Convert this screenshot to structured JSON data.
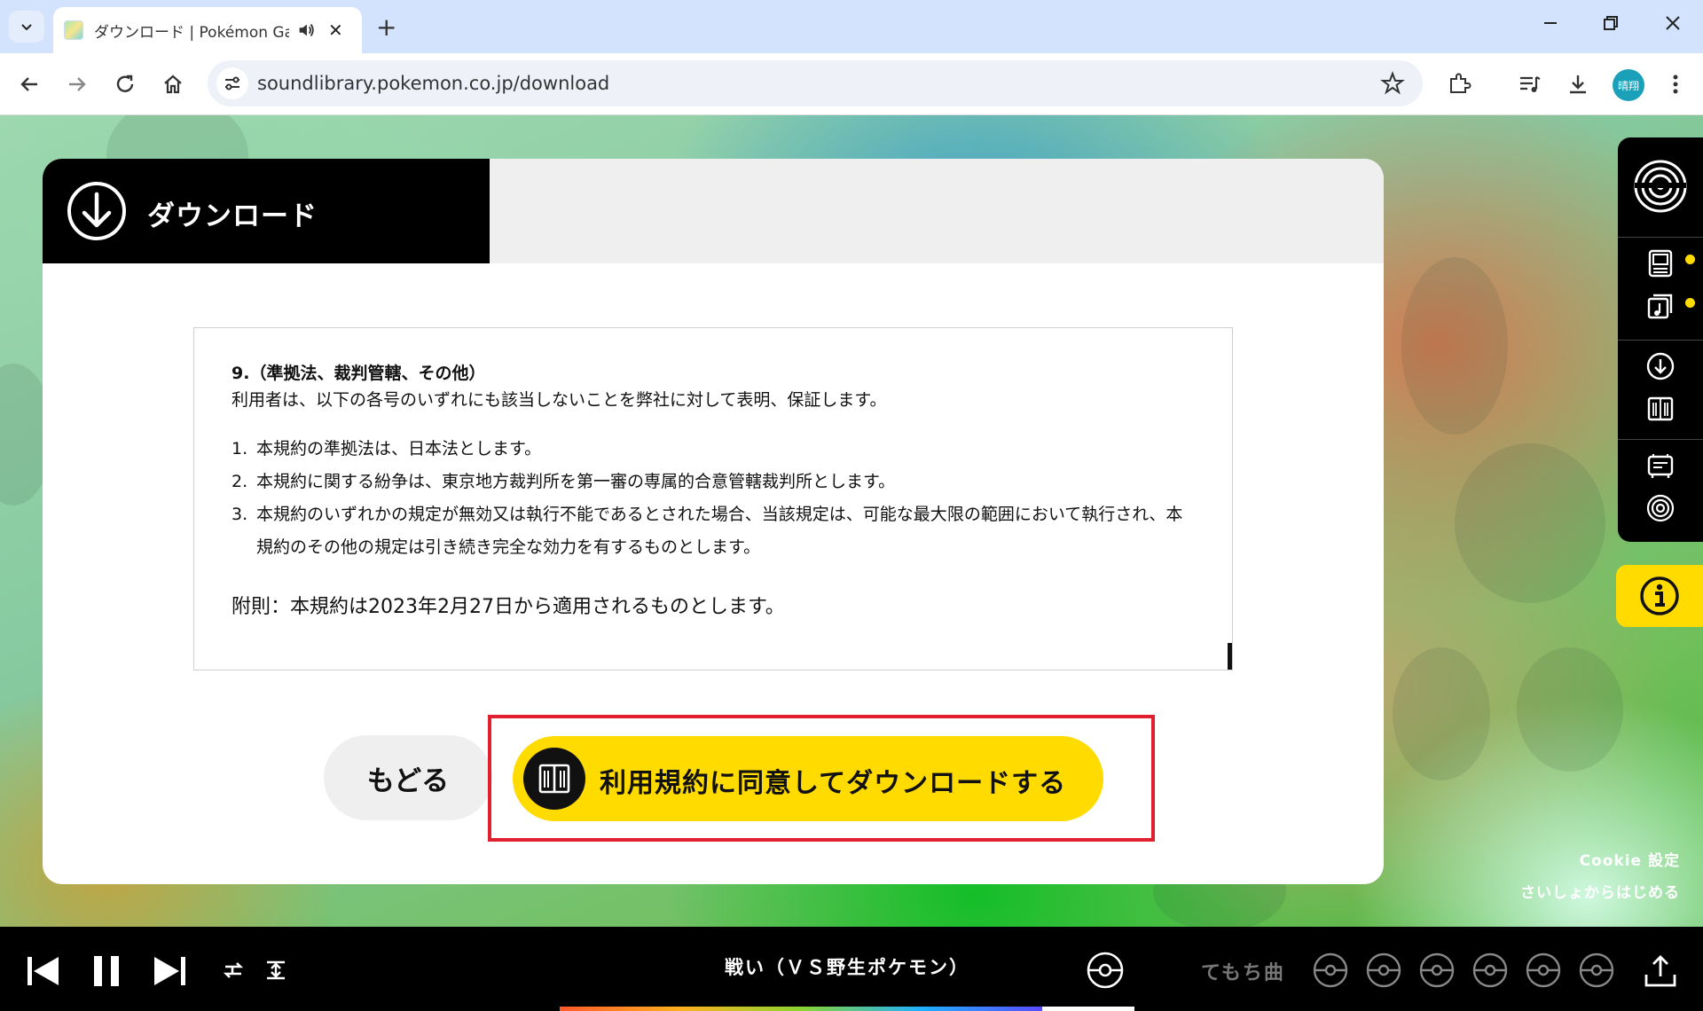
{
  "browser": {
    "tab_title": "ダウンロード | Pokémon Game",
    "new_tab": "+",
    "url": "soundlibrary.pokemon.co.jp/download",
    "profile_label": "晴翔"
  },
  "page": {
    "header_title": "ダウンロード",
    "terms": {
      "section_heading": "9.（準拠法、裁判管轄、その他）",
      "lead": "利用者は、以下の各号のいずれにも該当しないことを弊社に対して表明、保証します。",
      "items": [
        {
          "num": "1.",
          "text": "本規約の準拠法は、日本法とします。"
        },
        {
          "num": "2.",
          "text": "本規約に関する紛争は、東京地方裁判所を第一審の専属的合意管轄裁判所とします。"
        },
        {
          "num": "3.",
          "text": "本規約のいずれかの規定が無効又は執行不能であるとされた場合、当該規定は、可能な最大限の範囲において執行され、本規約のその他の規定は引き続き完全な効力を有するものとします。"
        }
      ],
      "supplementary": "附則：本規約は2023年2月27日から適用されるものとします。"
    },
    "back_button": "もどる",
    "agree_button": "利用規約に同意してダウンロードする",
    "cookie_link": "Cookie 設定",
    "restart_link": "さいしょからはじめる"
  },
  "player": {
    "track_title": "戦い（ＶＳ野生ポケモン）",
    "temochi_label": "てもち曲",
    "progress": 0.84
  },
  "colors": {
    "accent_yellow": "#ffdb00",
    "highlight_red": "#e0202e"
  }
}
